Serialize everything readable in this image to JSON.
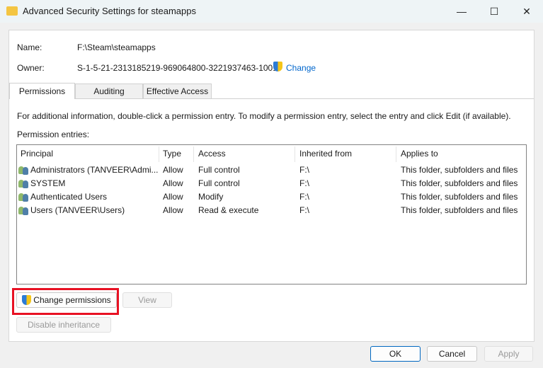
{
  "window": {
    "title": "Advanced Security Settings for steamapps"
  },
  "info": {
    "name_label": "Name:",
    "name_value": "F:\\Steam\\steamapps",
    "owner_label": "Owner:",
    "owner_value": "S-1-5-21-2313185219-969064800-3221937463-1001",
    "owner_change": "Change"
  },
  "tabs": [
    {
      "label": "Permissions",
      "active": true
    },
    {
      "label": "Auditing"
    },
    {
      "label": "Effective Access"
    }
  ],
  "permissions": {
    "instructions": "For additional information, double-click a permission entry. To modify a permission entry, select the entry and click Edit (if available).",
    "entries_label": "Permission entries:",
    "columns": [
      "Principal",
      "Type",
      "Access",
      "Inherited from",
      "Applies to"
    ],
    "rows": [
      [
        "Administrators (TANVEER\\Admi...",
        "Allow",
        "Full control",
        "F:\\",
        "This folder, subfolders and files"
      ],
      [
        "SYSTEM",
        "Allow",
        "Full control",
        "F:\\",
        "This folder, subfolders and files"
      ],
      [
        "Authenticated Users",
        "Allow",
        "Modify",
        "F:\\",
        "This folder, subfolders and files"
      ],
      [
        "Users (TANVEER\\Users)",
        "Allow",
        "Read & execute",
        "F:\\",
        "This folder, subfolders and files"
      ]
    ]
  },
  "buttons": {
    "change_permissions": "Change permissions",
    "view": "View",
    "disable_inheritance": "Disable inheritance",
    "ok": "OK",
    "cancel": "Cancel",
    "apply": "Apply"
  },
  "colors": {
    "highlight": "#e81123",
    "link": "#0066cc"
  }
}
